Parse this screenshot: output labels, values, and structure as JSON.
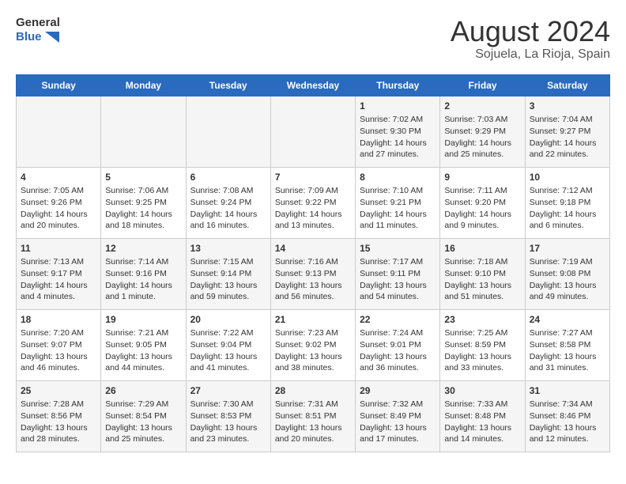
{
  "logo": {
    "text_general": "General",
    "text_blue": "Blue"
  },
  "title": "August 2024",
  "subtitle": "Sojuela, La Rioja, Spain",
  "days_of_week": [
    "Sunday",
    "Monday",
    "Tuesday",
    "Wednesday",
    "Thursday",
    "Friday",
    "Saturday"
  ],
  "weeks": [
    [
      {
        "day": "",
        "info": ""
      },
      {
        "day": "",
        "info": ""
      },
      {
        "day": "",
        "info": ""
      },
      {
        "day": "",
        "info": ""
      },
      {
        "day": "1",
        "info": "Sunrise: 7:02 AM\nSunset: 9:30 PM\nDaylight: 14 hours and 27 minutes."
      },
      {
        "day": "2",
        "info": "Sunrise: 7:03 AM\nSunset: 9:29 PM\nDaylight: 14 hours and 25 minutes."
      },
      {
        "day": "3",
        "info": "Sunrise: 7:04 AM\nSunset: 9:27 PM\nDaylight: 14 hours and 22 minutes."
      }
    ],
    [
      {
        "day": "4",
        "info": "Sunrise: 7:05 AM\nSunset: 9:26 PM\nDaylight: 14 hours and 20 minutes."
      },
      {
        "day": "5",
        "info": "Sunrise: 7:06 AM\nSunset: 9:25 PM\nDaylight: 14 hours and 18 minutes."
      },
      {
        "day": "6",
        "info": "Sunrise: 7:08 AM\nSunset: 9:24 PM\nDaylight: 14 hours and 16 minutes."
      },
      {
        "day": "7",
        "info": "Sunrise: 7:09 AM\nSunset: 9:22 PM\nDaylight: 14 hours and 13 minutes."
      },
      {
        "day": "8",
        "info": "Sunrise: 7:10 AM\nSunset: 9:21 PM\nDaylight: 14 hours and 11 minutes."
      },
      {
        "day": "9",
        "info": "Sunrise: 7:11 AM\nSunset: 9:20 PM\nDaylight: 14 hours and 9 minutes."
      },
      {
        "day": "10",
        "info": "Sunrise: 7:12 AM\nSunset: 9:18 PM\nDaylight: 14 hours and 6 minutes."
      }
    ],
    [
      {
        "day": "11",
        "info": "Sunrise: 7:13 AM\nSunset: 9:17 PM\nDaylight: 14 hours and 4 minutes."
      },
      {
        "day": "12",
        "info": "Sunrise: 7:14 AM\nSunset: 9:16 PM\nDaylight: 14 hours and 1 minute."
      },
      {
        "day": "13",
        "info": "Sunrise: 7:15 AM\nSunset: 9:14 PM\nDaylight: 13 hours and 59 minutes."
      },
      {
        "day": "14",
        "info": "Sunrise: 7:16 AM\nSunset: 9:13 PM\nDaylight: 13 hours and 56 minutes."
      },
      {
        "day": "15",
        "info": "Sunrise: 7:17 AM\nSunset: 9:11 PM\nDaylight: 13 hours and 54 minutes."
      },
      {
        "day": "16",
        "info": "Sunrise: 7:18 AM\nSunset: 9:10 PM\nDaylight: 13 hours and 51 minutes."
      },
      {
        "day": "17",
        "info": "Sunrise: 7:19 AM\nSunset: 9:08 PM\nDaylight: 13 hours and 49 minutes."
      }
    ],
    [
      {
        "day": "18",
        "info": "Sunrise: 7:20 AM\nSunset: 9:07 PM\nDaylight: 13 hours and 46 minutes."
      },
      {
        "day": "19",
        "info": "Sunrise: 7:21 AM\nSunset: 9:05 PM\nDaylight: 13 hours and 44 minutes."
      },
      {
        "day": "20",
        "info": "Sunrise: 7:22 AM\nSunset: 9:04 PM\nDaylight: 13 hours and 41 minutes."
      },
      {
        "day": "21",
        "info": "Sunrise: 7:23 AM\nSunset: 9:02 PM\nDaylight: 13 hours and 38 minutes."
      },
      {
        "day": "22",
        "info": "Sunrise: 7:24 AM\nSunset: 9:01 PM\nDaylight: 13 hours and 36 minutes."
      },
      {
        "day": "23",
        "info": "Sunrise: 7:25 AM\nSunset: 8:59 PM\nDaylight: 13 hours and 33 minutes."
      },
      {
        "day": "24",
        "info": "Sunrise: 7:27 AM\nSunset: 8:58 PM\nDaylight: 13 hours and 31 minutes."
      }
    ],
    [
      {
        "day": "25",
        "info": "Sunrise: 7:28 AM\nSunset: 8:56 PM\nDaylight: 13 hours and 28 minutes."
      },
      {
        "day": "26",
        "info": "Sunrise: 7:29 AM\nSunset: 8:54 PM\nDaylight: 13 hours and 25 minutes."
      },
      {
        "day": "27",
        "info": "Sunrise: 7:30 AM\nSunset: 8:53 PM\nDaylight: 13 hours and 23 minutes."
      },
      {
        "day": "28",
        "info": "Sunrise: 7:31 AM\nSunset: 8:51 PM\nDaylight: 13 hours and 20 minutes."
      },
      {
        "day": "29",
        "info": "Sunrise: 7:32 AM\nSunset: 8:49 PM\nDaylight: 13 hours and 17 minutes."
      },
      {
        "day": "30",
        "info": "Sunrise: 7:33 AM\nSunset: 8:48 PM\nDaylight: 13 hours and 14 minutes."
      },
      {
        "day": "31",
        "info": "Sunrise: 7:34 AM\nSunset: 8:46 PM\nDaylight: 13 hours and 12 minutes."
      }
    ]
  ]
}
